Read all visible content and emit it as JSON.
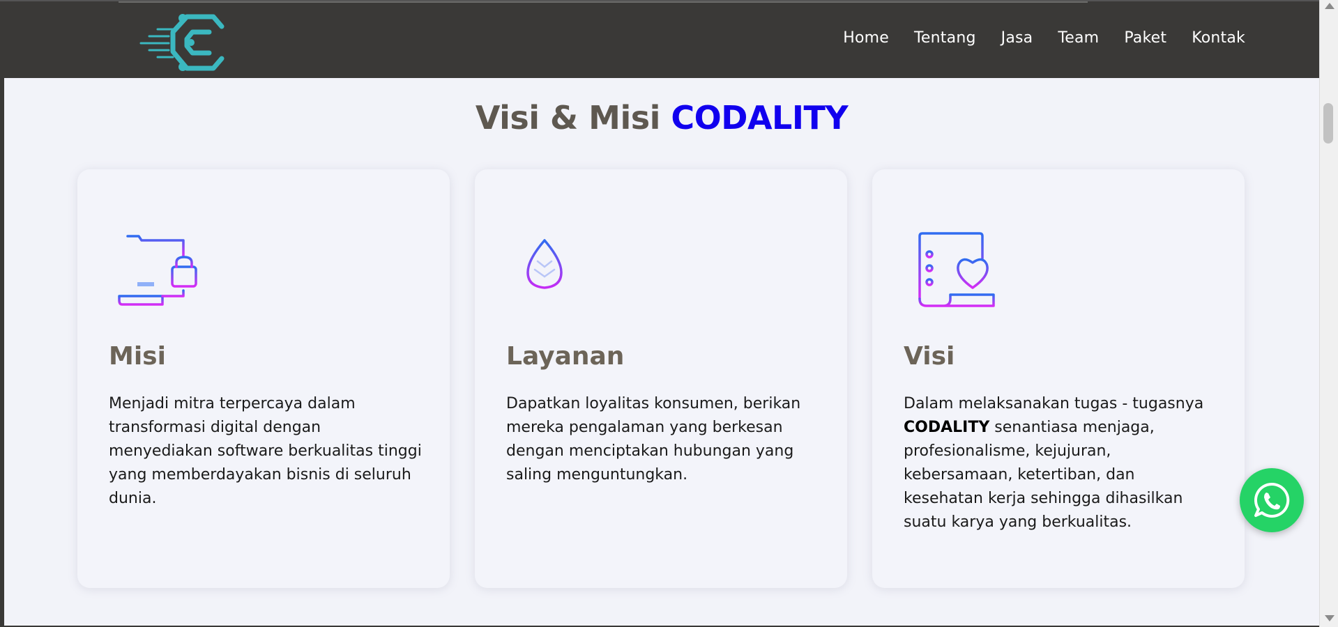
{
  "nav": {
    "logo_icon": "codality-logo",
    "links": [
      "Home",
      "Tentang",
      "Jasa",
      "Team",
      "Paket",
      "Kontak"
    ]
  },
  "section": {
    "title_prefix": "Visi & Misi",
    "title_brand": "CODALITY"
  },
  "cards": [
    {
      "icon": "document-basket-icon",
      "title": "Misi",
      "text": "Menjadi mitra terpercaya dalam transformasi digital dengan menyediakan software berkualitas tinggi yang memberdayakan bisnis di seluruh dunia."
    },
    {
      "icon": "leaf-icon",
      "title": "Layanan",
      "text": "Dapatkan loyalitas konsumen, berikan mereka pengalaman yang berkesan dengan menciptakan hubungan yang saling menguntungkan."
    },
    {
      "icon": "checklist-heart-icon",
      "title": "Visi",
      "text_before": "Dalam melaksanakan tugas - tugasnya",
      "text_bold": "CODALITY",
      "text_after": "senantiasa menjaga, profesionalisme, kejujuran, kebersamaan, ketertiban, dan kesehatan kerja sehingga dihasilkan suatu karya yang berkualitas."
    }
  ],
  "whatsapp": {
    "icon": "whatsapp-icon"
  },
  "colors": {
    "navbar_bg": "#3a3937",
    "page_bg": "#f2f3f9",
    "brand_blue": "#1100ee",
    "heading_gray": "#5e5850",
    "logo_teal": "#3bb8c0",
    "whatsapp_green": "#25d366"
  }
}
